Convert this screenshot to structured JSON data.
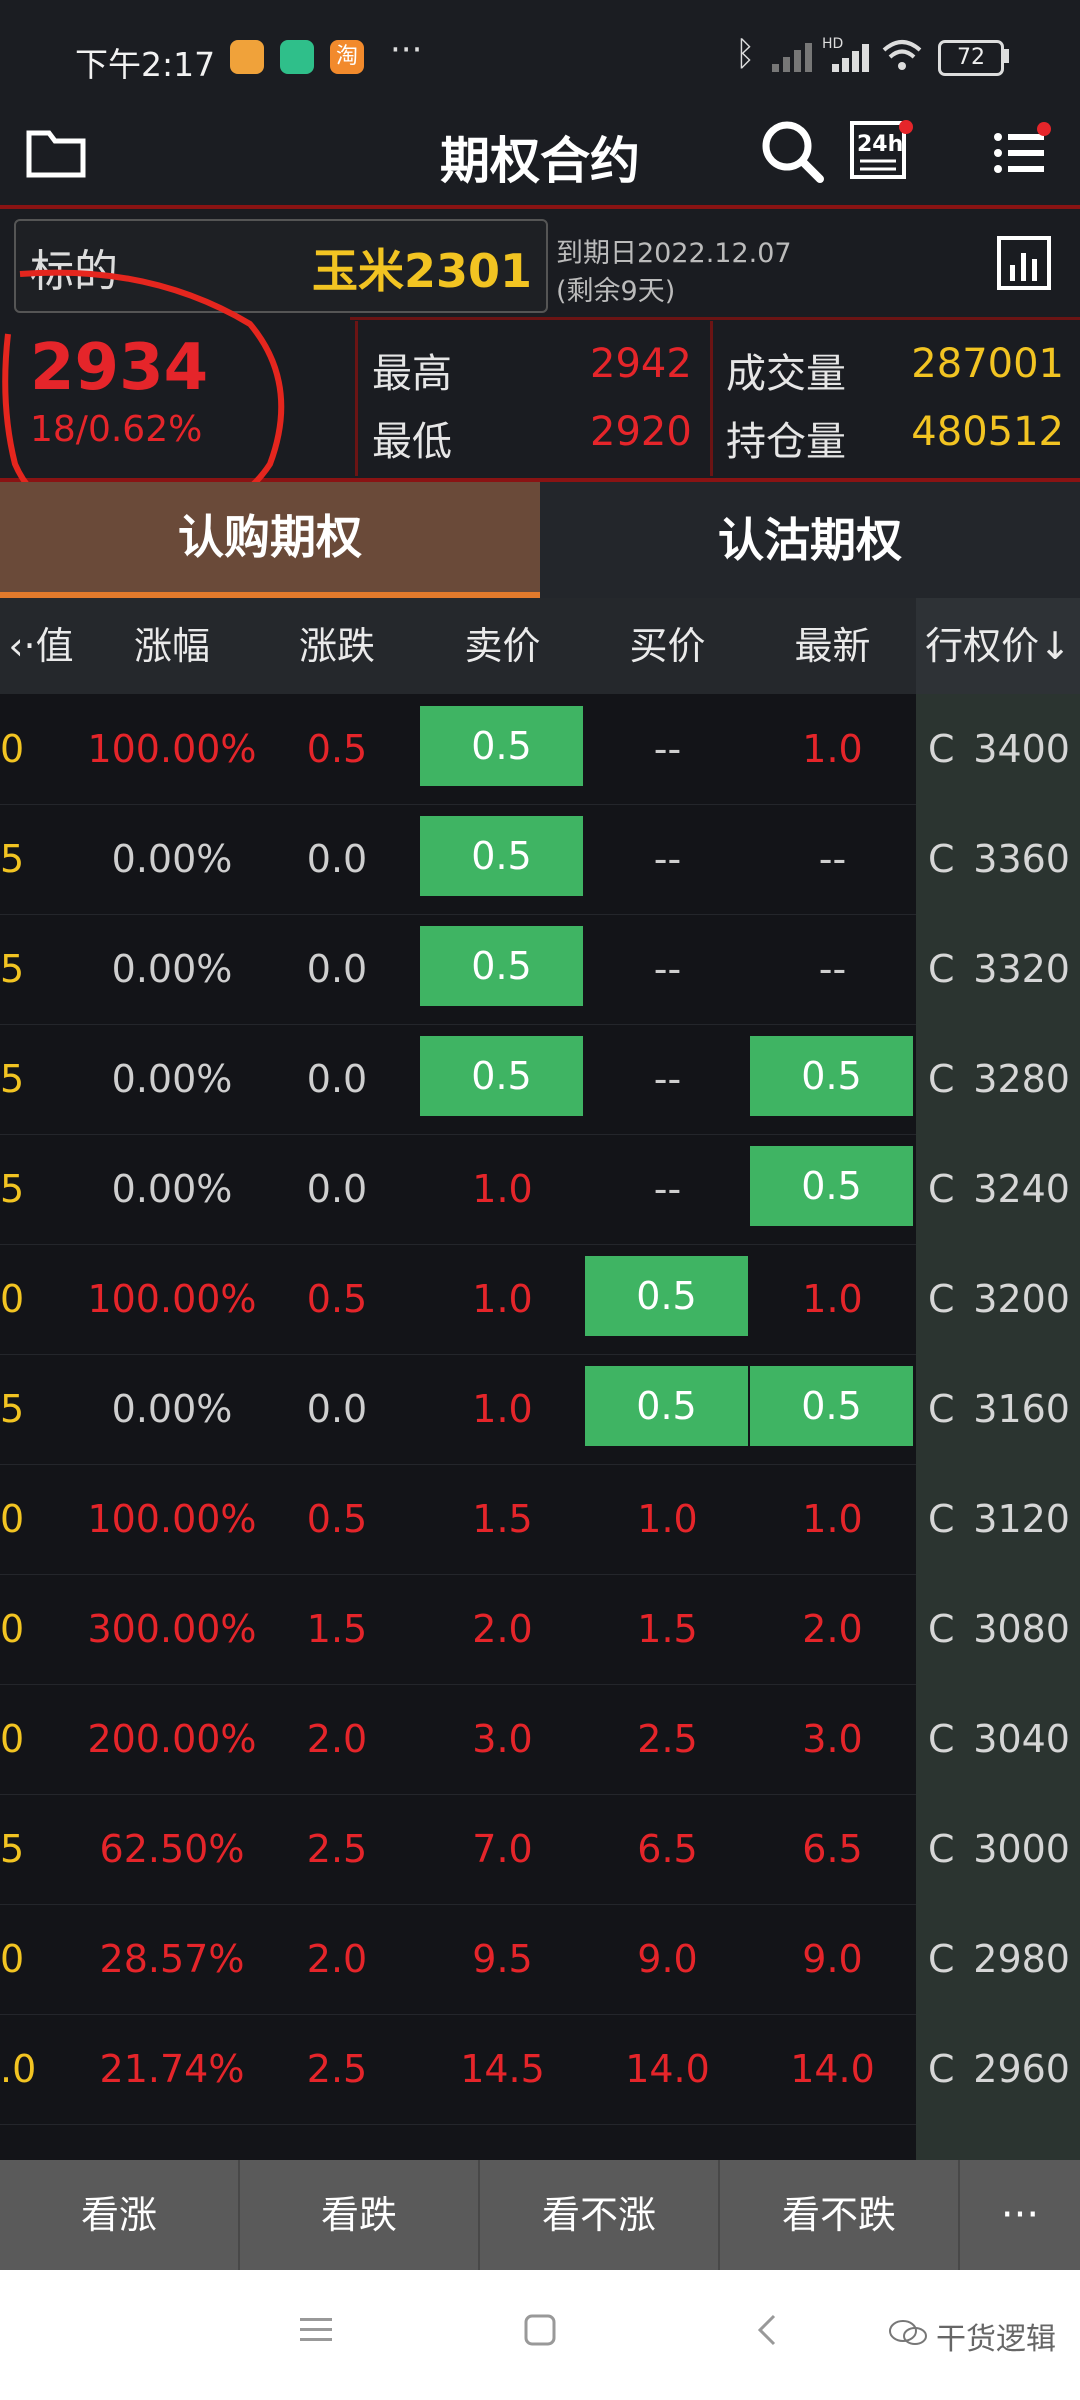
{
  "status_bar": {
    "time": "下午2:17",
    "battery": "72"
  },
  "navbar": {
    "title": "期权合约"
  },
  "underlying": {
    "label": "标的",
    "contract": "玉米2301",
    "expiry": "到期日2022.12.07",
    "remaining": "(剩余9天)",
    "price": "2934",
    "change": "18/0.62%",
    "high_label": "最高",
    "high": "2942",
    "low_label": "最低",
    "low": "2920",
    "volume_label": "成交量",
    "volume": "287001",
    "oi_label": "持仓量",
    "open_interest": "480512"
  },
  "tabs": {
    "call": "认购期权",
    "put": "认沽期权"
  },
  "columns": [
    "‹·值",
    "涨幅",
    "涨跌",
    "卖价",
    "买价",
    "最新",
    "行权价↓"
  ],
  "rows": [
    {
      "v": "0",
      "pct": "100.00%",
      "chg": "0.5",
      "ask": "0.5",
      "bid": "--",
      "last": "1.0",
      "type": "C",
      "strike": "3400",
      "pct_red": true,
      "chg_red": true,
      "ask_hl": true,
      "bid_hl": false,
      "last_hl": false,
      "ask_red": false,
      "bid_red": false,
      "last_red": true
    },
    {
      "v": "5",
      "pct": "0.00%",
      "chg": "0.0",
      "ask": "0.5",
      "bid": "--",
      "last": "--",
      "type": "C",
      "strike": "3360",
      "pct_red": false,
      "chg_red": false,
      "ask_hl": true,
      "bid_hl": false,
      "last_hl": false,
      "ask_red": false,
      "bid_red": false,
      "last_red": false
    },
    {
      "v": "5",
      "pct": "0.00%",
      "chg": "0.0",
      "ask": "0.5",
      "bid": "--",
      "last": "--",
      "type": "C",
      "strike": "3320",
      "pct_red": false,
      "chg_red": false,
      "ask_hl": true,
      "bid_hl": false,
      "last_hl": false,
      "ask_red": false,
      "bid_red": false,
      "last_red": false
    },
    {
      "v": "5",
      "pct": "0.00%",
      "chg": "0.0",
      "ask": "0.5",
      "bid": "--",
      "last": "0.5",
      "type": "C",
      "strike": "3280",
      "pct_red": false,
      "chg_red": false,
      "ask_hl": true,
      "bid_hl": false,
      "last_hl": true,
      "ask_red": false,
      "bid_red": false,
      "last_red": false
    },
    {
      "v": "5",
      "pct": "0.00%",
      "chg": "0.0",
      "ask": "1.0",
      "bid": "--",
      "last": "0.5",
      "type": "C",
      "strike": "3240",
      "pct_red": false,
      "chg_red": false,
      "ask_hl": false,
      "bid_hl": false,
      "last_hl": true,
      "ask_red": true,
      "bid_red": false,
      "last_red": false
    },
    {
      "v": "0",
      "pct": "100.00%",
      "chg": "0.5",
      "ask": "1.0",
      "bid": "0.5",
      "last": "1.0",
      "type": "C",
      "strike": "3200",
      "pct_red": true,
      "chg_red": true,
      "ask_hl": false,
      "bid_hl": true,
      "last_hl": false,
      "ask_red": true,
      "bid_red": false,
      "last_red": true
    },
    {
      "v": "5",
      "pct": "0.00%",
      "chg": "0.0",
      "ask": "1.0",
      "bid": "0.5",
      "last": "0.5",
      "type": "C",
      "strike": "3160",
      "pct_red": false,
      "chg_red": false,
      "ask_hl": false,
      "bid_hl": true,
      "last_hl": true,
      "ask_red": true,
      "bid_red": false,
      "last_red": false
    },
    {
      "v": "0",
      "pct": "100.00%",
      "chg": "0.5",
      "ask": "1.5",
      "bid": "1.0",
      "last": "1.0",
      "type": "C",
      "strike": "3120",
      "pct_red": true,
      "chg_red": true,
      "ask_hl": false,
      "bid_hl": false,
      "last_hl": false,
      "ask_red": true,
      "bid_red": true,
      "last_red": true
    },
    {
      "v": "0",
      "pct": "300.00%",
      "chg": "1.5",
      "ask": "2.0",
      "bid": "1.5",
      "last": "2.0",
      "type": "C",
      "strike": "3080",
      "pct_red": true,
      "chg_red": true,
      "ask_hl": false,
      "bid_hl": false,
      "last_hl": false,
      "ask_red": true,
      "bid_red": true,
      "last_red": true
    },
    {
      "v": "0",
      "pct": "200.00%",
      "chg": "2.0",
      "ask": "3.0",
      "bid": "2.5",
      "last": "3.0",
      "type": "C",
      "strike": "3040",
      "pct_red": true,
      "chg_red": true,
      "ask_hl": false,
      "bid_hl": false,
      "last_hl": false,
      "ask_red": true,
      "bid_red": true,
      "last_red": true
    },
    {
      "v": "5",
      "pct": "62.50%",
      "chg": "2.5",
      "ask": "7.0",
      "bid": "6.5",
      "last": "6.5",
      "type": "C",
      "strike": "3000",
      "pct_red": true,
      "chg_red": true,
      "ask_hl": false,
      "bid_hl": false,
      "last_hl": false,
      "ask_red": true,
      "bid_red": true,
      "last_red": true
    },
    {
      "v": "0",
      "pct": "28.57%",
      "chg": "2.0",
      "ask": "9.5",
      "bid": "9.0",
      "last": "9.0",
      "type": "C",
      "strike": "2980",
      "pct_red": true,
      "chg_red": true,
      "ask_hl": false,
      "bid_hl": false,
      "last_hl": false,
      "ask_red": true,
      "bid_red": true,
      "last_red": true
    },
    {
      "v": ".0",
      "pct": "21.74%",
      "chg": "2.5",
      "ask": "14.5",
      "bid": "14.0",
      "last": "14.0",
      "type": "C",
      "strike": "2960",
      "pct_red": true,
      "chg_red": true,
      "ask_hl": false,
      "bid_hl": false,
      "last_hl": false,
      "ask_red": true,
      "bid_red": true,
      "last_red": true
    }
  ],
  "toolbar": [
    "看涨",
    "看跌",
    "看不涨",
    "看不跌"
  ],
  "watermark": "干货逻辑",
  "colors": {
    "red": "#e5252a",
    "yellow": "#f2c422",
    "green": "#3fb463",
    "accent_orange": "#e27a2c"
  }
}
